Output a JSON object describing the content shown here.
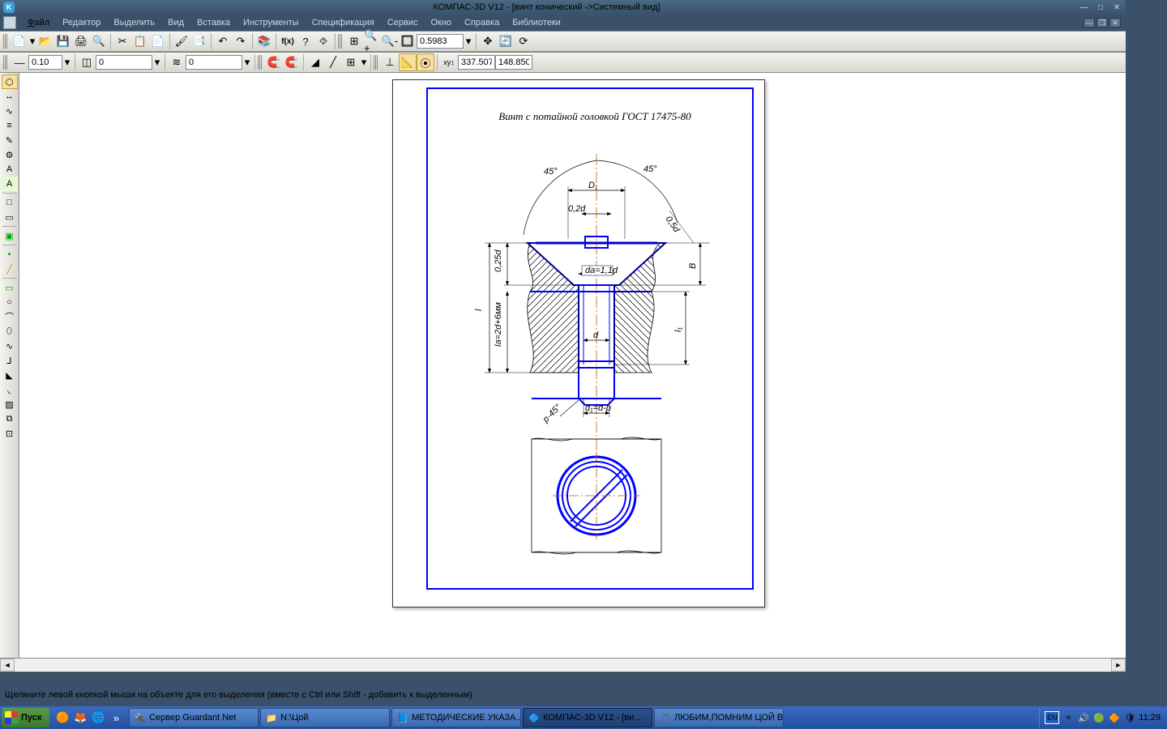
{
  "title_app": "КОМПАС-3D V12",
  "title_doc": " - [винт конический ->Системный вид]",
  "menu": {
    "file": "Файл",
    "edit": "Редактор",
    "select": "Выделить",
    "view": "Вид",
    "insert": "Вставка",
    "tools": "Инструменты",
    "spec": "Спецификация",
    "service": "Сервис",
    "window": "Окно",
    "help": "Справка",
    "libs": "Библиотеки"
  },
  "toolbar1": {
    "zoom": "0.5983"
  },
  "toolbar2": {
    "val1": "0.10",
    "val2": "0",
    "val3": "0",
    "coordX": "337.507",
    "coordY": "148.850"
  },
  "drawing": {
    "title": "Винт с потайной головкой ГОСТ 17475-80",
    "lbl_45l": "45°",
    "lbl_45r": "45°",
    "lbl_D1": "D₁",
    "lbl_02d": "0,2d",
    "lbl_05d": "0,5d",
    "lbl_025d": "0,25d",
    "lbl_l": "l",
    "lbl_la": "la=2d+6мм",
    "lbl_da": "da=1,1d",
    "lbl_d": "d",
    "lbl_B": "B",
    "lbl_l1": "l₁",
    "lbl_d1": "d₁=d-p",
    "lbl_p45": "p·45°"
  },
  "status_hint": "Щелкните левой кнопкой мыши на объекте для его выделения (вместе с Ctrl или Shift - добавить к выделенным)",
  "taskbar": {
    "start": "Пуск",
    "t1": "Сервер Guardant Net",
    "t2": "N:\\Цой",
    "t3": "МЕТОДИЧЕСКИЕ УКАЗА...",
    "t4": "КОМПАС-3D V12 - [ви...",
    "t5": "ЛЮБИМ,ПОМНИМ ЦОЙ В.",
    "lang": "EN",
    "clock": "11:29"
  }
}
